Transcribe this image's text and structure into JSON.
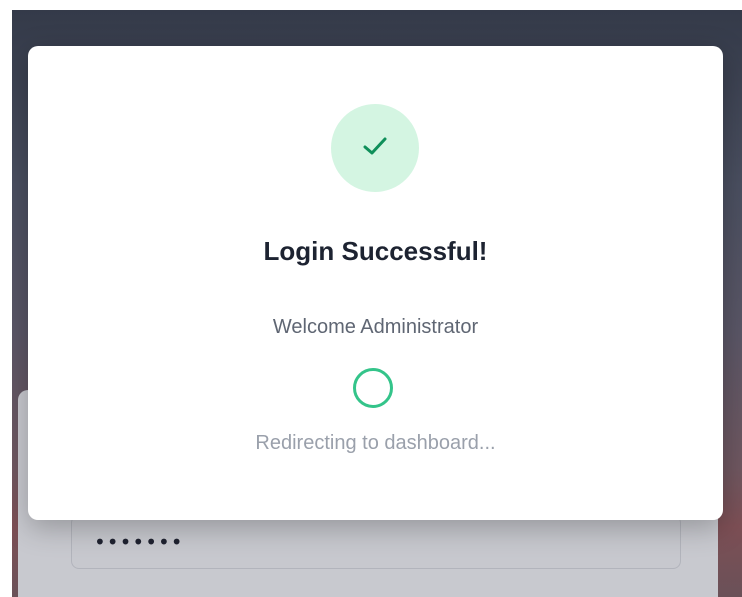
{
  "background_form": {
    "password_field": {
      "masked_value": "•••••••"
    }
  },
  "modal": {
    "icon": "checkmark-icon",
    "title": "Login Successful!",
    "message": "Welcome Administrator",
    "spinner_icon": "loading-spinner-icon",
    "status": "Redirecting to dashboard..."
  },
  "colors": {
    "success_circle_bg": "#d4f5e2",
    "success_accent": "#0f8f5a",
    "spinner": "#34c48a",
    "title": "#1d2331",
    "message": "#5f6673",
    "status": "#9aa0ab"
  }
}
